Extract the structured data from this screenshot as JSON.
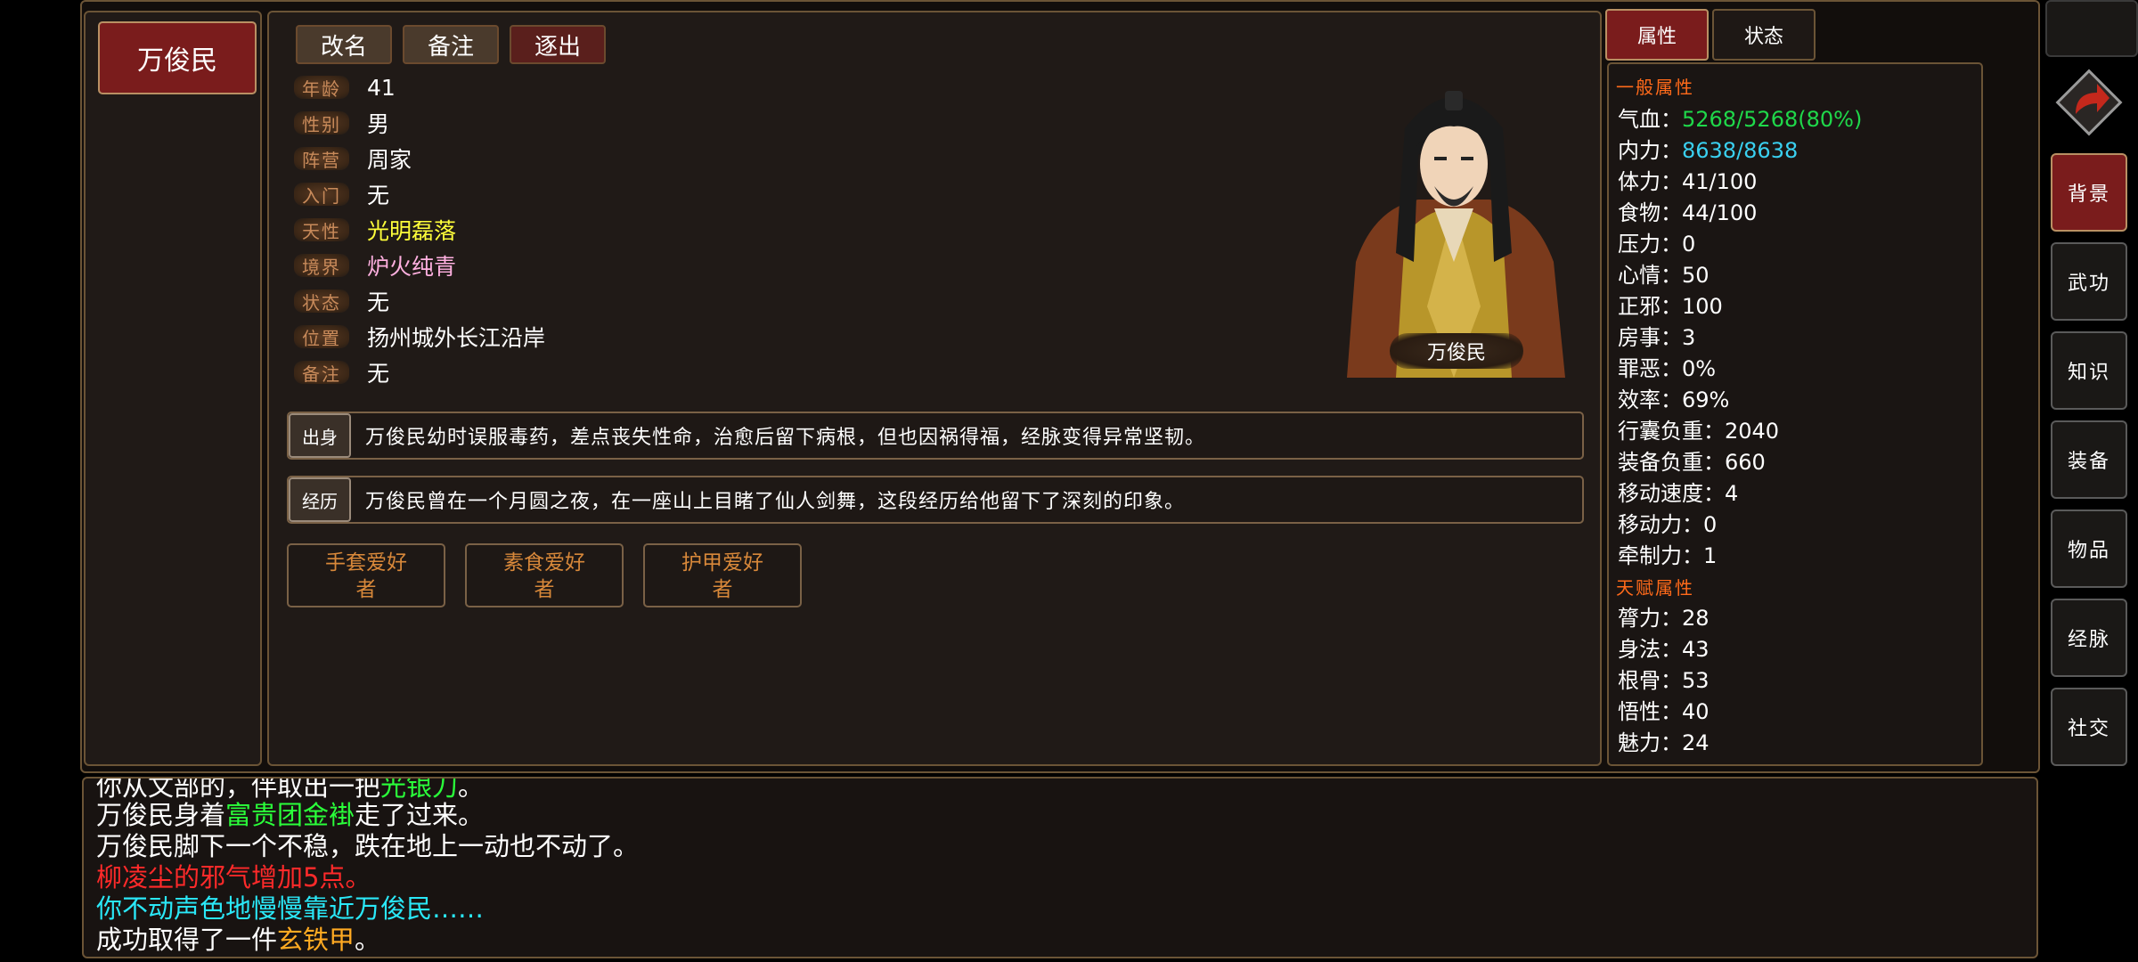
{
  "character": {
    "name": "万俊民"
  },
  "actions": {
    "rename": "改名",
    "note": "备注",
    "expel": "逐出"
  },
  "info": [
    {
      "label": "年龄",
      "value": "41"
    },
    {
      "label": "性别",
      "value": "男"
    },
    {
      "label": "阵营",
      "value": "周家"
    },
    {
      "label": "入门",
      "value": "无"
    },
    {
      "label": "天性",
      "value": "光明磊落"
    },
    {
      "label": "境界",
      "value": "炉火纯青"
    },
    {
      "label": "状态",
      "value": "无"
    },
    {
      "label": "位置",
      "value": "扬州城外长江沿岸"
    },
    {
      "label": "备注",
      "value": "无"
    }
  ],
  "story": {
    "origin_tag": "出身",
    "origin_text": "万俊民幼时误服毒药，差点丧失性命，治愈后留下病根，但也因祸得福，经脉变得异常坚韧。",
    "exp_tag": "经历",
    "exp_text": "万俊民曾在一个月圆之夜，在一座山上目睹了仙人剑舞，这段经历给他留下了深刻的印象。"
  },
  "hobbies": [
    {
      "line1": "手套爱好",
      "line2": "者"
    },
    {
      "line1": "素食爱好",
      "line2": "者"
    },
    {
      "line1": "护甲爱好",
      "line2": "者"
    }
  ],
  "portrait": {
    "caption": "万俊民"
  },
  "tabs": {
    "attributes": "属性",
    "status": "状态"
  },
  "attributes": {
    "general_title": "一般属性",
    "general": [
      {
        "label": "气血：",
        "value": "5268/5268(80%)",
        "color": "#1fd84a"
      },
      {
        "label": "内力：",
        "value": "8638/8638",
        "color": "#3ad0f0"
      },
      {
        "label": "体力：",
        "value": "41/100"
      },
      {
        "label": "食物：",
        "value": "44/100"
      },
      {
        "label": "压力：",
        "value": "0"
      },
      {
        "label": "心情：",
        "value": "50"
      },
      {
        "label": "正邪：",
        "value": "100"
      },
      {
        "label": "房事：",
        "value": "3"
      },
      {
        "label": "罪恶：",
        "value": "0%"
      },
      {
        "label": "效率：",
        "value": "69%"
      },
      {
        "label": "行囊负重：",
        "value": "2040"
      },
      {
        "label": "装备负重：",
        "value": "660"
      },
      {
        "label": "移动速度：",
        "value": "4"
      },
      {
        "label": "移动力：",
        "value": "0"
      },
      {
        "label": "牵制力：",
        "value": "1"
      }
    ],
    "talent_title": "天赋属性",
    "talent": [
      {
        "label": "膂力：",
        "value": "28"
      },
      {
        "label": "身法：",
        "value": "43"
      },
      {
        "label": "根骨：",
        "value": "53"
      },
      {
        "label": "悟性：",
        "value": "40"
      },
      {
        "label": "魅力：",
        "value": "24"
      }
    ]
  },
  "side_menu": [
    "背景",
    "武功",
    "知识",
    "装备",
    "物品",
    "经脉",
    "社交"
  ],
  "log": {
    "line1": {
      "a": "你从文部的，伴取出一把",
      "b": "光银刀",
      "c": "。"
    },
    "line2": {
      "a": "万俊民身着",
      "b": "富贵团金褂",
      "c": "走了过来。"
    },
    "line3": "万俊民脚下一个不稳，跌在地上一动也不动了。",
    "line4": "柳凌尘的邪气增加5点。",
    "line5": "你不动声色地慢慢靠近万俊民……",
    "line6": {
      "a": "成功取得了一件",
      "b": "玄铁甲",
      "c": "。"
    }
  }
}
